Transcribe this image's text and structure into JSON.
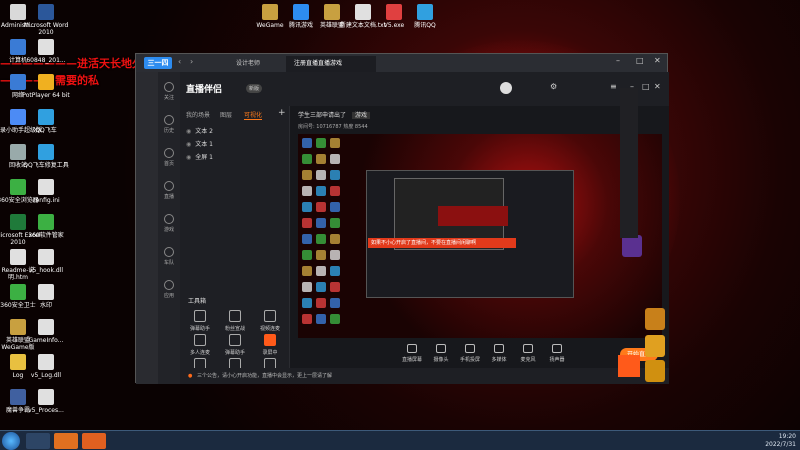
{
  "desktop": {
    "overlay_line1": "———————进活天长地久",
    "overlay_line2": "————，需要的私",
    "icons_left": [
      {
        "label": "Administr...",
        "color": "#d9d9d9"
      },
      {
        "label": "计算机",
        "color": "#3a7bd5"
      },
      {
        "label": "网络",
        "color": "#3a7bd5"
      },
      {
        "label": "广录小助手超级版",
        "color": "#4c8bf5"
      },
      {
        "label": "回收站",
        "color": "#9aa"
      },
      {
        "label": "360安全浏览器",
        "color": "#3cb043"
      },
      {
        "label": "Microsoft Excel 2010",
        "color": "#1f7a3a"
      },
      {
        "label": "Readme-说明.htm",
        "color": "#e0e0e0"
      },
      {
        "label": "360安全卫士",
        "color": "#3cb043"
      },
      {
        "label": "英雄联盟 WeGame版",
        "color": "#c8a040"
      },
      {
        "label": "Log",
        "color": "#e8c040"
      },
      {
        "label": "魔兽争霸",
        "color": "#4060a0"
      }
    ],
    "icons_left2": [
      {
        "label": "Microsoft Word 2010",
        "color": "#2b579a"
      },
      {
        "label": "60848_201...",
        "color": "#e0e0e0"
      },
      {
        "label": "PotPlayer 64 bit",
        "color": "#f0b020"
      },
      {
        "label": "QQ飞车",
        "color": "#30a0e0"
      },
      {
        "label": "QQ飞车修复工具",
        "color": "#30a0e0"
      },
      {
        "label": "config.ini",
        "color": "#e0e0e0"
      },
      {
        "label": "360软件管家",
        "color": "#3cb043"
      },
      {
        "label": "v5_hook.dll",
        "color": "#e0e0e0"
      },
      {
        "label": "水印",
        "color": "#e0e0e0"
      },
      {
        "label": "GameInfo...",
        "color": "#e0e0e0"
      },
      {
        "label": "v5_Log.dll",
        "color": "#e0e0e0"
      },
      {
        "label": "v5_Proces...",
        "color": "#e0e0e0"
      }
    ],
    "icons_top": [
      {
        "label": "WeGame",
        "color": "#c8a040"
      },
      {
        "label": "腾讯游戏",
        "color": "#2d8cf0"
      },
      {
        "label": "英雄联盟",
        "color": "#c8a040"
      },
      {
        "label": "新建文本文档.txt",
        "color": "#e0e0e0"
      },
      {
        "label": "V5.exe",
        "color": "#e04040"
      },
      {
        "label": "腾讯QQ",
        "color": "#30a0e0"
      }
    ]
  },
  "taskbar": {
    "time": "19:20",
    "date": "2022/7/31"
  },
  "window": {
    "logo": "三一四",
    "tabs": [
      "设计老师",
      "注册直播直播游戏"
    ],
    "rail": [
      "关注",
      "历史",
      "首页",
      "直播",
      "游戏",
      "车队",
      "应用"
    ]
  },
  "app": {
    "title": "直播伴侣",
    "badge": "新版",
    "panel_tabs": [
      "我的场景",
      "图层",
      "可视化"
    ],
    "layers": [
      "文本 2",
      "文本 1",
      "全屏 1"
    ],
    "tools_title": "工具箱",
    "tools": [
      "弹幕助手",
      "粉丝宣战",
      "视频连麦",
      "多人连麦",
      "弹幕助手",
      "录屏中",
      "虚拟形象",
      "弹幕助",
      "数据助手"
    ],
    "room_title": "学生三部申请出了",
    "room_tag": "游戏",
    "room_meta": "房间号: 10716787   热度 8544",
    "preview_banner": "如果不小心开启了直播间，不要在直播间闲聊啊",
    "bottom_buttons": [
      "直播屏幕",
      "摄像头",
      "手机投屏",
      "多媒体",
      "麦克风",
      "扬声器"
    ],
    "start_live": "开始直播",
    "notice": "三个公告，请小心开启功能，直播中会显示，更上一层请了解"
  },
  "colors": {
    "accent": "#ff7a1a",
    "brand": "#2d8cf0",
    "bg": "#1c1d22"
  }
}
